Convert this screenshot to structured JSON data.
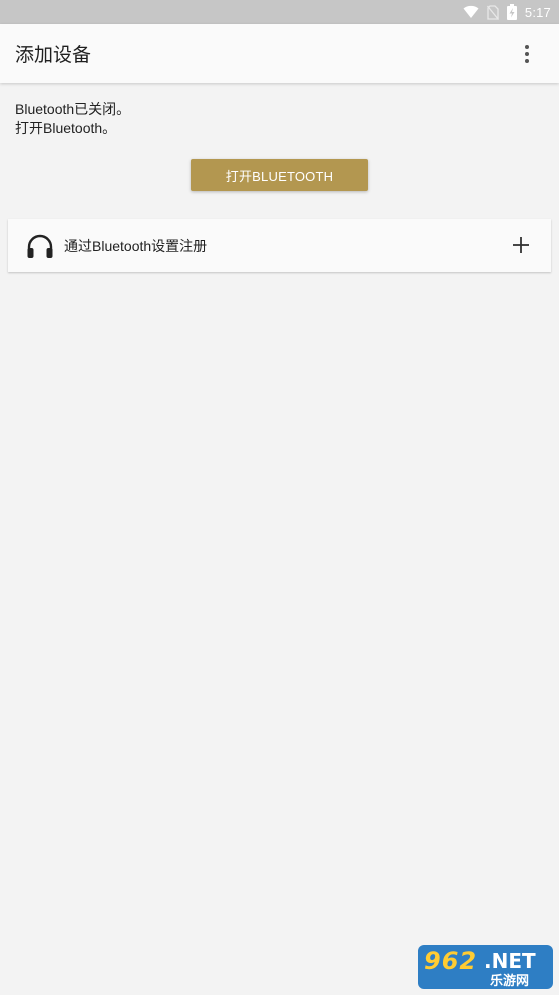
{
  "status_bar": {
    "time": "5:17",
    "icons": [
      "wifi-icon",
      "no-sim-icon",
      "battery-charging-icon"
    ]
  },
  "app_bar": {
    "title": "添加设备",
    "menu_icon": "more-vert-icon"
  },
  "bluetooth": {
    "status_line1": "Bluetooth已关闭。",
    "status_line2": "打开Bluetooth。",
    "enable_button": "打开BLUETOOTH",
    "button_color": "#b39750"
  },
  "register_item": {
    "icon": "headphones-icon",
    "label": "通过Bluetooth设置注册",
    "action_icon": "plus-icon"
  },
  "watermark": {
    "brand": "962",
    "suffix": ".NET",
    "subtitle": "乐游网"
  }
}
